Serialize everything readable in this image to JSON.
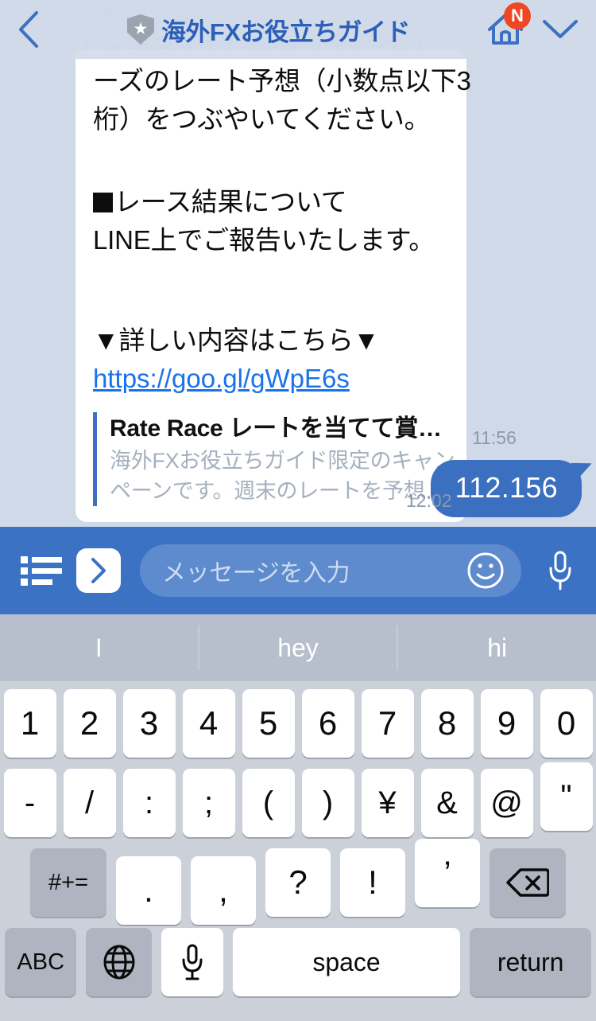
{
  "header": {
    "back_icon": "chevron-left-icon",
    "badge_icon": "official-account-shield-star-icon",
    "title": "海外FXお役立ちガイド",
    "home_icon": "home-icon",
    "home_badge": "N",
    "collapse_icon": "chevron-down-icon"
  },
  "chat": {
    "scrolled_under": {
      "line1": "参加方法",
      "line2": "上記期日までに9/21（金）クロ"
    },
    "received_message": {
      "lines": [
        "ーズのレート予想（小数点以下3",
        "桁）をつぶやいてください。"
      ],
      "section_heading": "レース結果について",
      "section_line": "LINE上でご報告いたします。",
      "cta": "▼詳しい内容はこちら▼",
      "url": "https://goo.gl/gWpE6s",
      "preview_title": "Rate Race レートを当てて賞…",
      "preview_desc_line1": "海外FXお役立ちガイド限定のキャン",
      "preview_desc_line2": "ペーンです。週末のレートを予想…",
      "timestamp": "11:56"
    },
    "sent_message": {
      "text": "112.156",
      "timestamp": "12:02"
    }
  },
  "input_bar": {
    "list_icon": "menu-list-icon",
    "expand_icon": "chevron-right-icon",
    "placeholder": "メッセージを入力",
    "emoji_icon": "smiley-face-icon",
    "mic_icon": "microphone-icon"
  },
  "suggestions": [
    "I",
    "hey",
    "hi"
  ],
  "keyboard": {
    "row1": [
      "1",
      "2",
      "3",
      "4",
      "5",
      "6",
      "7",
      "8",
      "9",
      "0"
    ],
    "row2": [
      "-",
      "/",
      ":",
      ";",
      "(",
      ")",
      "¥",
      "&",
      "@",
      "\""
    ],
    "row3": {
      "symbols_key": "#+=",
      "keys": [
        ".",
        ",",
        "?",
        "!",
        "’"
      ],
      "backspace_icon": "backspace-delete-icon"
    },
    "row4": {
      "abc": "ABC",
      "globe_icon": "globe-language-icon",
      "mic_icon": "microphone-icon",
      "space": "space",
      "return": "return"
    }
  },
  "colors": {
    "chat_background": "#cfd9e8",
    "input_bar_blue": "#3b72c4",
    "sent_bubble_blue": "#3b6fc0",
    "title_blue": "#2c5fb8",
    "link_blue": "#1a73e8",
    "badge_red": "#ef4623",
    "keyboard_background": "#ccd1d9",
    "key_white": "#ffffff",
    "key_gray": "#aeb5c0",
    "suggestion_bar": "#b7bfcc"
  }
}
